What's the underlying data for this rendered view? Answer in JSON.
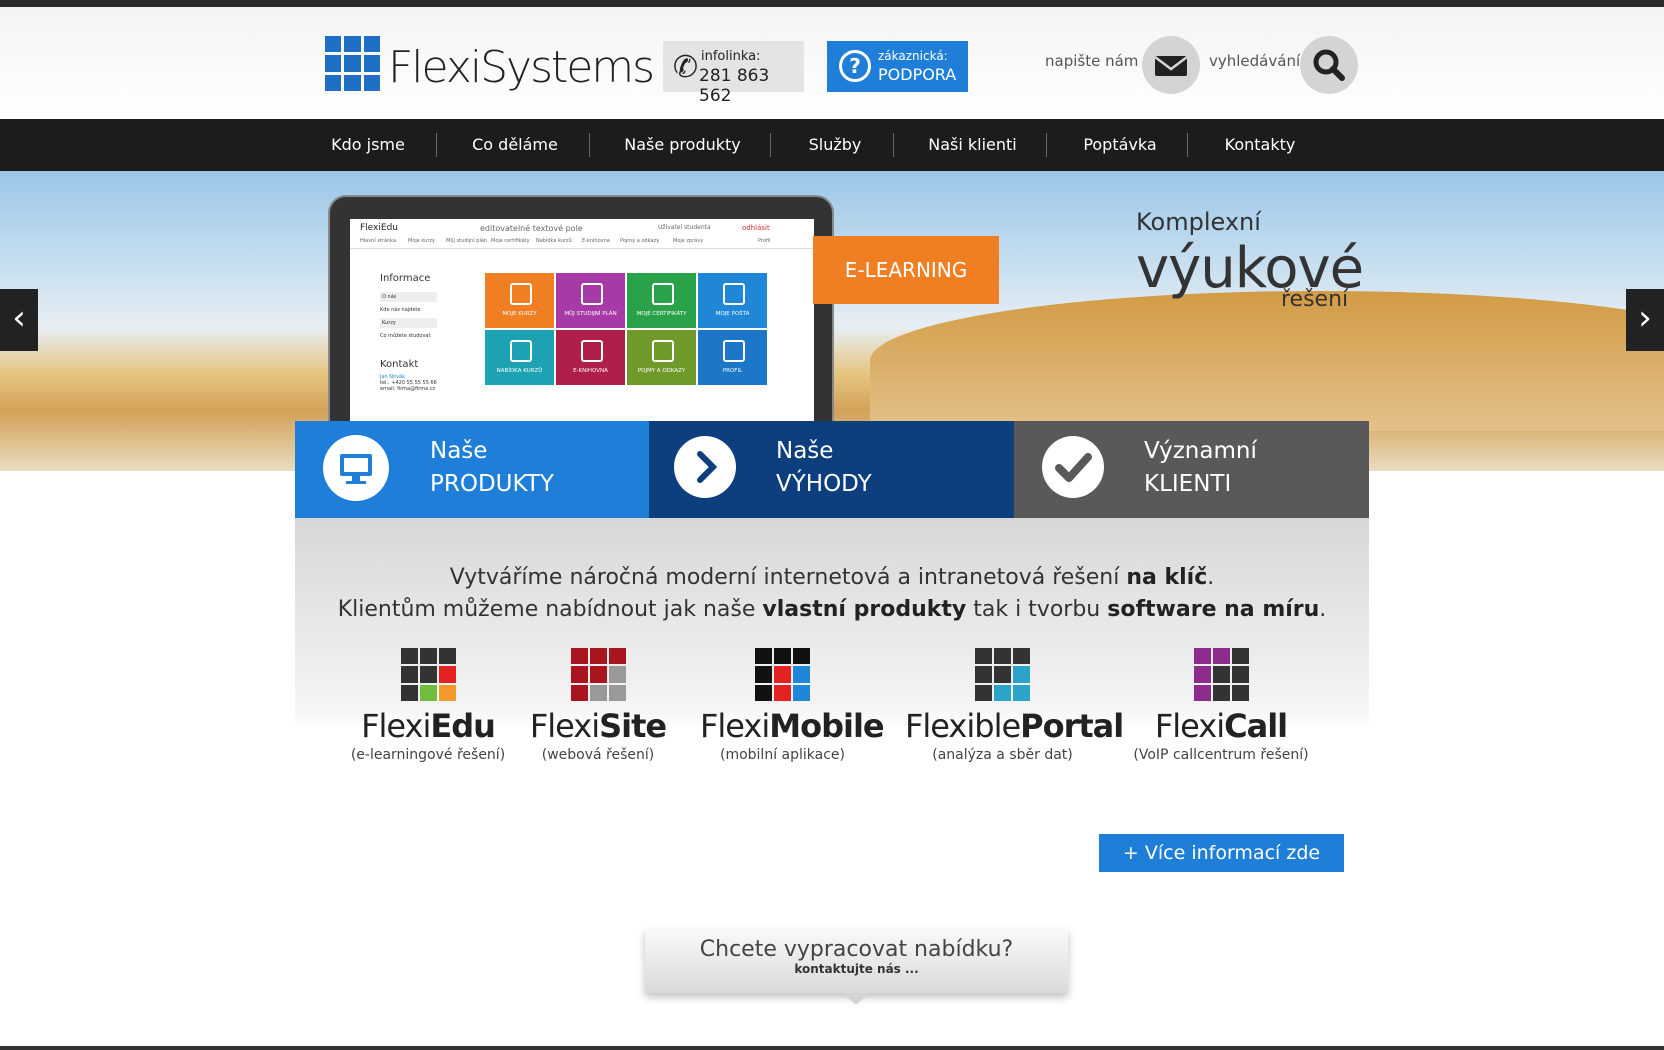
{
  "header": {
    "logo_text": "FlexiSystems",
    "infolinka_label": "infolinka:",
    "infolinka_phone": "281 863 562",
    "support_label": "zákaznická:",
    "support_title": "PODPORA",
    "write_us": "napište nám",
    "search": "vyhledávání"
  },
  "nav": [
    "Kdo jsme",
    "Co děláme",
    "Naše produkty",
    "Služby",
    "Naši klienti",
    "Poptávka",
    "Kontakty"
  ],
  "hero": {
    "badge": "E-LEARNING",
    "slogan_small": "Komplexní",
    "slogan_big": "výukové",
    "slogan_end": "řešení",
    "screen": {
      "app_name": "FlexiEdu",
      "field": "editovatelné textové pole",
      "user": "Uživatel studenta",
      "logout": "odhlásit",
      "menu": [
        "Hlavní stránka",
        "Moje kurzy",
        "Můj studijní plán",
        "Moje certifikáty",
        "Nabídka kurzů",
        "E-knihovna",
        "Pojmy a odkazy",
        "Moje zprávy",
        "Profil"
      ],
      "side_title": "Informace",
      "side_items": [
        "O nás",
        "Kde nás najdete",
        "Kurzy",
        "Co můžete studovat"
      ],
      "contact_title": "Kontakt",
      "contact_name": "Jan Novák",
      "contact_tel": "tel.: +420 55 55 55 66",
      "contact_email": "email: firma@firma.cz",
      "tiles": [
        {
          "label": "MOJE KURZY",
          "color": "#f07f23"
        },
        {
          "label": "MŮJ STUDIJNÍ PLÁN",
          "color": "#a63aa6"
        },
        {
          "label": "MOJE CERTIFIKÁTY",
          "color": "#2aa24a"
        },
        {
          "label": "MOJE POŠTA",
          "color": "#1f87d6"
        },
        {
          "label": "NABÍDKA KURZŮ",
          "color": "#1da2b3"
        },
        {
          "label": "E-KNIHOVNA",
          "color": "#b01e4a"
        },
        {
          "label": "POJMY A ODKAZY",
          "color": "#6f9a2a"
        },
        {
          "label": "PROFIL",
          "color": "#1c77c8"
        }
      ]
    }
  },
  "tabs": [
    {
      "t1": "Naše",
      "t2": "PRODUKTY",
      "color": "#1f7fd8",
      "icon": "monitor-icon"
    },
    {
      "t1": "Naše",
      "t2": "VÝHODY",
      "color": "#0d3f7e",
      "icon": "chevron-right-icon"
    },
    {
      "t1": "Významní",
      "t2": "KLIENTI",
      "color": "#595959",
      "icon": "check-icon"
    }
  ],
  "intro": {
    "l1a": "Vytváříme náročná moderní internetová a intranetová řešení",
    "l1b": "na klíč",
    "l1c": ".",
    "l2a": "Klientům můžeme nabídnout jak naše",
    "l2b": "vlastní produkty",
    "l2c": "tak i tvorbu",
    "l2d": "software na míru",
    "l2e": "."
  },
  "products": [
    {
      "a": "Flexi",
      "b": "Edu",
      "desc": "(e-learningové řešení)",
      "colors": [
        "#333",
        "#333",
        "#333",
        "#333",
        "#333",
        "#e52222",
        "#333",
        "#6fbe3d",
        "#f39a2a"
      ]
    },
    {
      "a": "Flexi",
      "b": "Site",
      "desc": "(webová řešení)",
      "colors": [
        "#a8151f",
        "#a8151f",
        "#a8151f",
        "#a8151f",
        "#a8151f",
        "#999",
        "#a8151f",
        "#999",
        "#999"
      ]
    },
    {
      "a": "Flexi",
      "b": "Mobile",
      "desc": "(mobilní aplikace)",
      "colors": [
        "#111",
        "#111",
        "#111",
        "#111",
        "#e52222",
        "#1f87d6",
        "#111",
        "#e52222",
        "#1f87d6"
      ]
    },
    {
      "a": "Flexible",
      "b": "Portal",
      "desc": "(analýza a sběr dat)",
      "colors": [
        "#333",
        "#333",
        "#333",
        "#333",
        "#333",
        "#2da3c9",
        "#333",
        "#2da3c9",
        "#2da3c9"
      ]
    },
    {
      "a": "Flexi",
      "b": "Call",
      "desc": "(VoIP callcentrum řešení)",
      "colors": [
        "#8e2c8e",
        "#8e2c8e",
        "#333",
        "#8e2c8e",
        "#333",
        "#333",
        "#8e2c8e",
        "#333",
        "#333"
      ]
    }
  ],
  "more_button": "+ Více informací zde",
  "offer": {
    "title": "Chcete vypracovat nabídku?",
    "sub": "kontaktujte nás ..."
  }
}
